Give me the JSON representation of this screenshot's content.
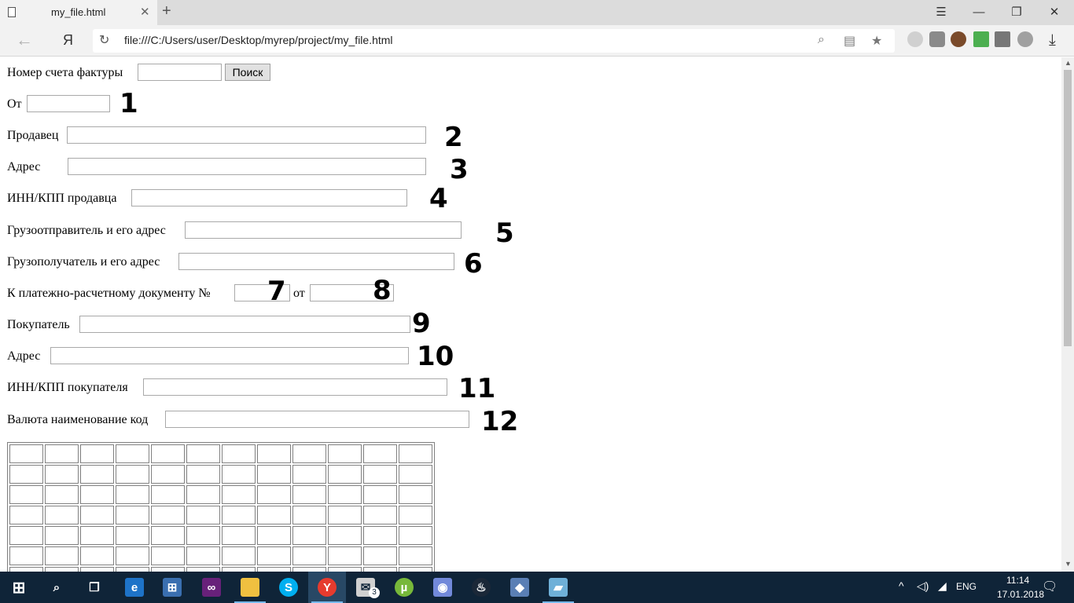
{
  "browser": {
    "tab_title": "my_file.html",
    "url": "file:///C:/Users/user/Desktop/myrep/project/my_file.html",
    "yandex_button": "Я"
  },
  "form": {
    "invoice_label": "Номер счета фактуры",
    "search_button": "Поиск",
    "from_label": "От",
    "seller_label": "Продавец",
    "seller_address_label": "Адрес",
    "seller_inn_label": "ИНН/КПП продавца",
    "shipper_label": "Грузоотправитель и его адрес",
    "consignee_label": "Грузополучатель и его адрес",
    "payment_doc_label": "К платежно-расчетному документу №",
    "payment_doc_from_label": "от",
    "buyer_label": "Покупатель",
    "buyer_address_label": "Адрес",
    "buyer_inn_label": "ИНН/КПП покупателя",
    "currency_label": "Валюта наименование код"
  },
  "annotations": [
    "1",
    "2",
    "3",
    "4",
    "5",
    "6",
    "7",
    "8",
    "9",
    "10",
    "11",
    "12"
  ],
  "grid": {
    "columns": 12,
    "visible_rows": 7
  },
  "taskbar": {
    "mail_badge": "3",
    "language": "ENG",
    "time": "11:14",
    "date": "17.01.2018"
  }
}
